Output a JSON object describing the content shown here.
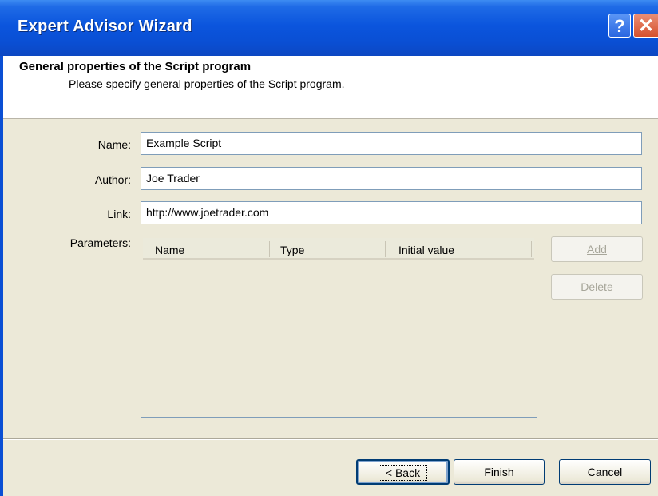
{
  "window": {
    "title": "Expert Advisor Wizard",
    "help_label": "?",
    "close_label": "✕"
  },
  "header": {
    "title": "General properties of the Script program",
    "subtitle": "Please specify general properties of the Script program."
  },
  "form": {
    "name_label": "Name:",
    "name_value": "Example Script",
    "author_label": "Author:",
    "author_value": "Joe Trader",
    "link_label": "Link:",
    "link_value": "http://www.joetrader.com",
    "parameters_label": "Parameters:"
  },
  "parameters_table": {
    "columns": [
      "Name",
      "Type",
      "Initial value"
    ],
    "rows": []
  },
  "side_buttons": {
    "add_label": "Add",
    "delete_label": "Delete"
  },
  "footer_buttons": {
    "back_label": "< Back",
    "finish_label": "Finish",
    "cancel_label": "Cancel"
  },
  "colors": {
    "titlebar": "#0a4fd4",
    "dialog_body": "#ece9d8",
    "field_border": "#7f9db9"
  }
}
